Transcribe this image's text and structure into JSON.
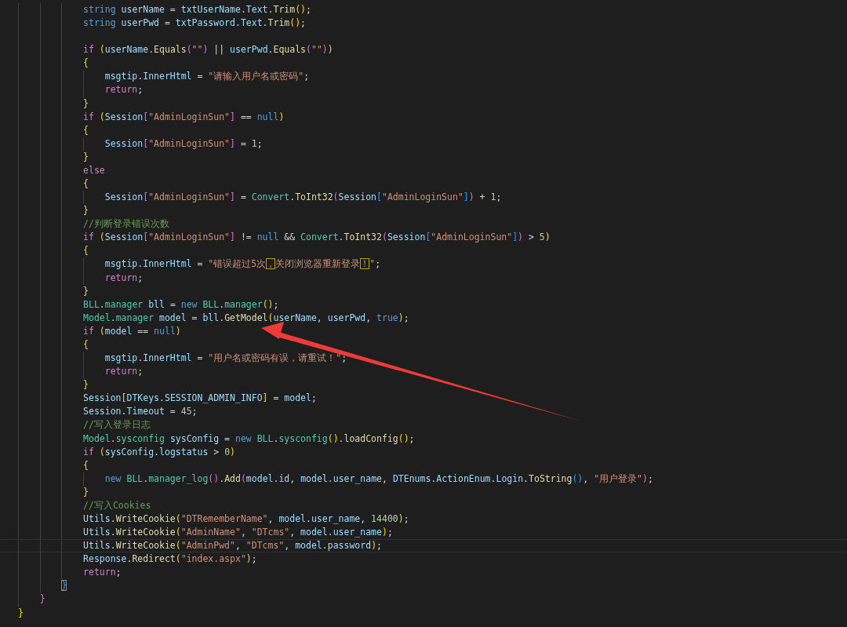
{
  "editor": {
    "lines": [
      {
        "kind": "code",
        "current": false,
        "tokens": [
          {
            "kind": "kw",
            "text": "            string "
          },
          {
            "kind": "var",
            "text": "userName"
          },
          {
            "kind": "plain",
            "text": " = "
          },
          {
            "kind": "var",
            "text": "txtUserName"
          },
          {
            "kind": "plain",
            "text": "."
          },
          {
            "kind": "var",
            "text": "Text"
          },
          {
            "kind": "plain",
            "text": "."
          },
          {
            "kind": "fn",
            "text": "Trim"
          },
          {
            "kind": "br1",
            "text": "()"
          },
          {
            "kind": "plain",
            "text": ";"
          }
        ]
      },
      {
        "kind": "code",
        "current": false,
        "tokens": [
          {
            "kind": "kw",
            "text": "            string "
          },
          {
            "kind": "var",
            "text": "userPwd"
          },
          {
            "kind": "plain",
            "text": " = "
          },
          {
            "kind": "var",
            "text": "txtPassword"
          },
          {
            "kind": "plain",
            "text": "."
          },
          {
            "kind": "var",
            "text": "Text"
          },
          {
            "kind": "plain",
            "text": "."
          },
          {
            "kind": "fn",
            "text": "Trim"
          },
          {
            "kind": "br1",
            "text": "()"
          },
          {
            "kind": "plain",
            "text": ";"
          }
        ]
      },
      {
        "kind": "blank",
        "current": false
      },
      {
        "kind": "code",
        "current": false,
        "tokens": [
          {
            "kind": "ctl",
            "text": "            if "
          },
          {
            "kind": "br1",
            "text": "("
          },
          {
            "kind": "var",
            "text": "userName"
          },
          {
            "kind": "plain",
            "text": "."
          },
          {
            "kind": "fn",
            "text": "Equals"
          },
          {
            "kind": "br2",
            "text": "("
          },
          {
            "kind": "str",
            "text": "\"\""
          },
          {
            "kind": "br2",
            "text": ")"
          },
          {
            "kind": "plain",
            "text": " || "
          },
          {
            "kind": "var",
            "text": "userPwd"
          },
          {
            "kind": "plain",
            "text": "."
          },
          {
            "kind": "fn",
            "text": "Equals"
          },
          {
            "kind": "br2",
            "text": "("
          },
          {
            "kind": "str",
            "text": "\"\""
          },
          {
            "kind": "br2",
            "text": ")"
          },
          {
            "kind": "br1",
            "text": ")"
          }
        ]
      },
      {
        "kind": "code",
        "current": false,
        "tokens": [
          {
            "kind": "br1",
            "text": "            {"
          }
        ]
      },
      {
        "kind": "code",
        "current": false,
        "tokens": [
          {
            "kind": "var",
            "text": "                msgtip"
          },
          {
            "kind": "plain",
            "text": "."
          },
          {
            "kind": "var",
            "text": "InnerHtml"
          },
          {
            "kind": "plain",
            "text": " = "
          },
          {
            "kind": "str",
            "text": "\"请输入用户名或密码\""
          },
          {
            "kind": "plain",
            "text": ";"
          }
        ]
      },
      {
        "kind": "code",
        "current": false,
        "tokens": [
          {
            "kind": "ctl",
            "text": "                return"
          },
          {
            "kind": "plain",
            "text": ";"
          }
        ]
      },
      {
        "kind": "code",
        "current": false,
        "tokens": [
          {
            "kind": "br1",
            "text": "            }"
          }
        ]
      },
      {
        "kind": "code",
        "current": false,
        "tokens": [
          {
            "kind": "ctl",
            "text": "            if "
          },
          {
            "kind": "br1",
            "text": "("
          },
          {
            "kind": "var",
            "text": "Session"
          },
          {
            "kind": "br2",
            "text": "["
          },
          {
            "kind": "str",
            "text": "\"AdminLoginSun\""
          },
          {
            "kind": "br2",
            "text": "]"
          },
          {
            "kind": "plain",
            "text": " == "
          },
          {
            "kind": "kw",
            "text": "null"
          },
          {
            "kind": "br1",
            "text": ")"
          }
        ]
      },
      {
        "kind": "code",
        "current": false,
        "tokens": [
          {
            "kind": "br1",
            "text": "            {"
          }
        ]
      },
      {
        "kind": "code",
        "current": false,
        "tokens": [
          {
            "kind": "var",
            "text": "                Session"
          },
          {
            "kind": "br2",
            "text": "["
          },
          {
            "kind": "str",
            "text": "\"AdminLoginSun\""
          },
          {
            "kind": "br2",
            "text": "]"
          },
          {
            "kind": "plain",
            "text": " = "
          },
          {
            "kind": "num",
            "text": "1"
          },
          {
            "kind": "plain",
            "text": ";"
          }
        ]
      },
      {
        "kind": "code",
        "current": false,
        "tokens": [
          {
            "kind": "br1",
            "text": "            }"
          }
        ]
      },
      {
        "kind": "code",
        "current": false,
        "tokens": [
          {
            "kind": "ctl",
            "text": "            else"
          }
        ]
      },
      {
        "kind": "code",
        "current": false,
        "tokens": [
          {
            "kind": "br1",
            "text": "            {"
          }
        ]
      },
      {
        "kind": "code",
        "current": false,
        "tokens": [
          {
            "kind": "var",
            "text": "                Session"
          },
          {
            "kind": "br2",
            "text": "["
          },
          {
            "kind": "str",
            "text": "\"AdminLoginSun\""
          },
          {
            "kind": "br2",
            "text": "]"
          },
          {
            "kind": "plain",
            "text": " = "
          },
          {
            "kind": "type",
            "text": "Convert"
          },
          {
            "kind": "plain",
            "text": "."
          },
          {
            "kind": "fn",
            "text": "ToInt32"
          },
          {
            "kind": "br2",
            "text": "("
          },
          {
            "kind": "var",
            "text": "Session"
          },
          {
            "kind": "br3",
            "text": "["
          },
          {
            "kind": "str",
            "text": "\"AdminLoginSun\""
          },
          {
            "kind": "br3",
            "text": "]"
          },
          {
            "kind": "br2",
            "text": ")"
          },
          {
            "kind": "plain",
            "text": " + "
          },
          {
            "kind": "num",
            "text": "1"
          },
          {
            "kind": "plain",
            "text": ";"
          }
        ]
      },
      {
        "kind": "code",
        "current": false,
        "tokens": [
          {
            "kind": "br1",
            "text": "            }"
          }
        ]
      },
      {
        "kind": "code",
        "current": false,
        "tokens": [
          {
            "kind": "com",
            "text": "            //判断登录错误次数"
          }
        ]
      },
      {
        "kind": "code",
        "current": false,
        "tokens": [
          {
            "kind": "ctl",
            "text": "            if "
          },
          {
            "kind": "br1",
            "text": "("
          },
          {
            "kind": "var",
            "text": "Session"
          },
          {
            "kind": "br2",
            "text": "["
          },
          {
            "kind": "str",
            "text": "\"AdminLoginSun\""
          },
          {
            "kind": "br2",
            "text": "]"
          },
          {
            "kind": "plain",
            "text": " != "
          },
          {
            "kind": "kw",
            "text": "null"
          },
          {
            "kind": "plain",
            "text": " && "
          },
          {
            "kind": "type",
            "text": "Convert"
          },
          {
            "kind": "plain",
            "text": "."
          },
          {
            "kind": "fn",
            "text": "ToInt32"
          },
          {
            "kind": "br2",
            "text": "("
          },
          {
            "kind": "var",
            "text": "Session"
          },
          {
            "kind": "br3",
            "text": "["
          },
          {
            "kind": "str",
            "text": "\"AdminLoginSun\""
          },
          {
            "kind": "br3",
            "text": "]"
          },
          {
            "kind": "br2",
            "text": ")"
          },
          {
            "kind": "plain",
            "text": " > "
          },
          {
            "kind": "num",
            "text": "5"
          },
          {
            "kind": "br1",
            "text": ")"
          }
        ]
      },
      {
        "kind": "code",
        "current": false,
        "tokens": [
          {
            "kind": "br1",
            "text": "            {"
          }
        ]
      },
      {
        "kind": "code",
        "current": false,
        "tokens": [
          {
            "kind": "var",
            "text": "                msgtip"
          },
          {
            "kind": "plain",
            "text": "."
          },
          {
            "kind": "var",
            "text": "InnerHtml"
          },
          {
            "kind": "plain",
            "text": " = "
          },
          {
            "kind": "str",
            "text": "\"错误超过5次"
          },
          {
            "kind": "flag",
            "text": "，"
          },
          {
            "kind": "str",
            "text": "关闭浏览器重新登录"
          },
          {
            "kind": "flag",
            "text": "！"
          },
          {
            "kind": "str",
            "text": "\""
          },
          {
            "kind": "plain",
            "text": ";"
          }
        ]
      },
      {
        "kind": "code",
        "current": false,
        "tokens": [
          {
            "kind": "ctl",
            "text": "                return"
          },
          {
            "kind": "plain",
            "text": ";"
          }
        ]
      },
      {
        "kind": "code",
        "current": false,
        "tokens": [
          {
            "kind": "br1",
            "text": "            }"
          }
        ]
      },
      {
        "kind": "code",
        "current": false,
        "tokens": [
          {
            "kind": "type",
            "text": "            BLL"
          },
          {
            "kind": "plain",
            "text": "."
          },
          {
            "kind": "type",
            "text": "manager "
          },
          {
            "kind": "var",
            "text": "bll"
          },
          {
            "kind": "plain",
            "text": " = "
          },
          {
            "kind": "kw",
            "text": "new "
          },
          {
            "kind": "type",
            "text": "BLL"
          },
          {
            "kind": "plain",
            "text": "."
          },
          {
            "kind": "type",
            "text": "manager"
          },
          {
            "kind": "br1",
            "text": "()"
          },
          {
            "kind": "plain",
            "text": ";"
          }
        ]
      },
      {
        "kind": "code",
        "current": false,
        "tokens": [
          {
            "kind": "type",
            "text": "            Model"
          },
          {
            "kind": "plain",
            "text": "."
          },
          {
            "kind": "type",
            "text": "manager "
          },
          {
            "kind": "var",
            "text": "model"
          },
          {
            "kind": "plain",
            "text": " = "
          },
          {
            "kind": "var",
            "text": "bll"
          },
          {
            "kind": "plain",
            "text": "."
          },
          {
            "kind": "fn",
            "text": "GetModel"
          },
          {
            "kind": "br1",
            "text": "("
          },
          {
            "kind": "var",
            "text": "userName"
          },
          {
            "kind": "plain",
            "text": ", "
          },
          {
            "kind": "var",
            "text": "userPwd"
          },
          {
            "kind": "plain",
            "text": ", "
          },
          {
            "kind": "kw",
            "text": "true"
          },
          {
            "kind": "br1",
            "text": ")"
          },
          {
            "kind": "plain",
            "text": ";"
          }
        ]
      },
      {
        "kind": "code",
        "current": false,
        "tokens": [
          {
            "kind": "ctl",
            "text": "            if "
          },
          {
            "kind": "br1",
            "text": "("
          },
          {
            "kind": "var",
            "text": "model"
          },
          {
            "kind": "plain",
            "text": " == "
          },
          {
            "kind": "kw",
            "text": "null"
          },
          {
            "kind": "br1",
            "text": ")"
          }
        ]
      },
      {
        "kind": "code",
        "current": false,
        "tokens": [
          {
            "kind": "br1",
            "text": "            {"
          }
        ]
      },
      {
        "kind": "code",
        "current": false,
        "tokens": [
          {
            "kind": "var",
            "text": "                msgtip"
          },
          {
            "kind": "plain",
            "text": "."
          },
          {
            "kind": "var",
            "text": "InnerHtml"
          },
          {
            "kind": "plain",
            "text": " = "
          },
          {
            "kind": "str",
            "text": "\"用户名或密码有误，请重试！\""
          },
          {
            "kind": "plain",
            "text": ";"
          }
        ]
      },
      {
        "kind": "code",
        "current": false,
        "tokens": [
          {
            "kind": "ctl",
            "text": "                return"
          },
          {
            "kind": "plain",
            "text": ";"
          }
        ]
      },
      {
        "kind": "code",
        "current": false,
        "tokens": [
          {
            "kind": "br1",
            "text": "            }"
          }
        ]
      },
      {
        "kind": "code",
        "current": false,
        "tokens": [
          {
            "kind": "var",
            "text": "            Session"
          },
          {
            "kind": "br1",
            "text": "["
          },
          {
            "kind": "var",
            "text": "DTKeys"
          },
          {
            "kind": "plain",
            "text": "."
          },
          {
            "kind": "var",
            "text": "SESSION_ADMIN_INFO"
          },
          {
            "kind": "br1",
            "text": "]"
          },
          {
            "kind": "plain",
            "text": " = "
          },
          {
            "kind": "var",
            "text": "model"
          },
          {
            "kind": "plain",
            "text": ";"
          }
        ]
      },
      {
        "kind": "code",
        "current": false,
        "tokens": [
          {
            "kind": "var",
            "text": "            Session"
          },
          {
            "kind": "plain",
            "text": "."
          },
          {
            "kind": "var",
            "text": "Timeout"
          },
          {
            "kind": "plain",
            "text": " = "
          },
          {
            "kind": "num",
            "text": "45"
          },
          {
            "kind": "plain",
            "text": ";"
          }
        ]
      },
      {
        "kind": "code",
        "current": false,
        "tokens": [
          {
            "kind": "com",
            "text": "            //写入登录日志"
          }
        ]
      },
      {
        "kind": "code",
        "current": false,
        "tokens": [
          {
            "kind": "type",
            "text": "            Model"
          },
          {
            "kind": "plain",
            "text": "."
          },
          {
            "kind": "type",
            "text": "sysconfig "
          },
          {
            "kind": "var",
            "text": "sysConfig"
          },
          {
            "kind": "plain",
            "text": " = "
          },
          {
            "kind": "kw",
            "text": "new "
          },
          {
            "kind": "type",
            "text": "BLL"
          },
          {
            "kind": "plain",
            "text": "."
          },
          {
            "kind": "type",
            "text": "sysconfig"
          },
          {
            "kind": "br1",
            "text": "()"
          },
          {
            "kind": "plain",
            "text": "."
          },
          {
            "kind": "fn",
            "text": "loadConfig"
          },
          {
            "kind": "br1",
            "text": "()"
          },
          {
            "kind": "plain",
            "text": ";"
          }
        ]
      },
      {
        "kind": "code",
        "current": false,
        "tokens": [
          {
            "kind": "ctl",
            "text": "            if "
          },
          {
            "kind": "br1",
            "text": "("
          },
          {
            "kind": "var",
            "text": "sysConfig"
          },
          {
            "kind": "plain",
            "text": "."
          },
          {
            "kind": "var",
            "text": "logstatus"
          },
          {
            "kind": "plain",
            "text": " > "
          },
          {
            "kind": "num",
            "text": "0"
          },
          {
            "kind": "br1",
            "text": ")"
          }
        ]
      },
      {
        "kind": "code",
        "current": false,
        "tokens": [
          {
            "kind": "br1",
            "text": "            {"
          }
        ]
      },
      {
        "kind": "code",
        "current": false,
        "tokens": [
          {
            "kind": "kw",
            "text": "                new "
          },
          {
            "kind": "type",
            "text": "BLL"
          },
          {
            "kind": "plain",
            "text": "."
          },
          {
            "kind": "type",
            "text": "manager_log"
          },
          {
            "kind": "br2",
            "text": "()"
          },
          {
            "kind": "plain",
            "text": "."
          },
          {
            "kind": "fn",
            "text": "Add"
          },
          {
            "kind": "br2",
            "text": "("
          },
          {
            "kind": "var",
            "text": "model"
          },
          {
            "kind": "plain",
            "text": "."
          },
          {
            "kind": "var",
            "text": "id"
          },
          {
            "kind": "plain",
            "text": ", "
          },
          {
            "kind": "var",
            "text": "model"
          },
          {
            "kind": "plain",
            "text": "."
          },
          {
            "kind": "var",
            "text": "user_name"
          },
          {
            "kind": "plain",
            "text": ", "
          },
          {
            "kind": "var",
            "text": "DTEnums"
          },
          {
            "kind": "plain",
            "text": "."
          },
          {
            "kind": "var",
            "text": "ActionEnum"
          },
          {
            "kind": "plain",
            "text": "."
          },
          {
            "kind": "var",
            "text": "Login"
          },
          {
            "kind": "plain",
            "text": "."
          },
          {
            "kind": "fn",
            "text": "ToString"
          },
          {
            "kind": "br3",
            "text": "()"
          },
          {
            "kind": "plain",
            "text": ", "
          },
          {
            "kind": "str",
            "text": "\"用户登录\""
          },
          {
            "kind": "br2",
            "text": ")"
          },
          {
            "kind": "plain",
            "text": ";"
          }
        ]
      },
      {
        "kind": "code",
        "current": false,
        "tokens": [
          {
            "kind": "br1",
            "text": "            }"
          }
        ]
      },
      {
        "kind": "code",
        "current": false,
        "tokens": [
          {
            "kind": "com",
            "text": "            //写入Cookies"
          }
        ]
      },
      {
        "kind": "code",
        "current": false,
        "tokens": [
          {
            "kind": "var",
            "text": "            Utils"
          },
          {
            "kind": "plain",
            "text": "."
          },
          {
            "kind": "fn",
            "text": "WriteCookie"
          },
          {
            "kind": "br1",
            "text": "("
          },
          {
            "kind": "str",
            "text": "\"DTRememberName\""
          },
          {
            "kind": "plain",
            "text": ", "
          },
          {
            "kind": "var",
            "text": "model"
          },
          {
            "kind": "plain",
            "text": "."
          },
          {
            "kind": "var",
            "text": "user_name"
          },
          {
            "kind": "plain",
            "text": ", "
          },
          {
            "kind": "num",
            "text": "14400"
          },
          {
            "kind": "br1",
            "text": ")"
          },
          {
            "kind": "plain",
            "text": ";"
          }
        ]
      },
      {
        "kind": "code",
        "current": false,
        "tokens": [
          {
            "kind": "var",
            "text": "            Utils"
          },
          {
            "kind": "plain",
            "text": "."
          },
          {
            "kind": "fn",
            "text": "WriteCookie"
          },
          {
            "kind": "br1",
            "text": "("
          },
          {
            "kind": "str",
            "text": "\"AdminName\""
          },
          {
            "kind": "plain",
            "text": ", "
          },
          {
            "kind": "str",
            "text": "\"DTcms\""
          },
          {
            "kind": "plain",
            "text": ", "
          },
          {
            "kind": "var",
            "text": "model"
          },
          {
            "kind": "plain",
            "text": "."
          },
          {
            "kind": "var",
            "text": "user_name"
          },
          {
            "kind": "br1",
            "text": ")"
          },
          {
            "kind": "plain",
            "text": ";"
          }
        ]
      },
      {
        "kind": "code",
        "current": true,
        "tokens": [
          {
            "kind": "var",
            "text": "            Utils"
          },
          {
            "kind": "plain",
            "text": "."
          },
          {
            "kind": "fn",
            "text": "WriteCookie"
          },
          {
            "kind": "br1",
            "text": "("
          },
          {
            "kind": "str",
            "text": "\"AdminPwd\""
          },
          {
            "kind": "plain",
            "text": ", "
          },
          {
            "kind": "str",
            "text": "\"DTcms\""
          },
          {
            "kind": "plain",
            "text": ", "
          },
          {
            "kind": "var",
            "text": "model"
          },
          {
            "kind": "plain",
            "text": "."
          },
          {
            "kind": "var",
            "text": "password"
          },
          {
            "kind": "br1",
            "text": ")"
          },
          {
            "kind": "plain",
            "text": ";"
          }
        ]
      },
      {
        "kind": "code",
        "current": false,
        "tokens": [
          {
            "kind": "var",
            "text": "            Response"
          },
          {
            "kind": "plain",
            "text": "."
          },
          {
            "kind": "fn",
            "text": "Redirect"
          },
          {
            "kind": "br1",
            "text": "("
          },
          {
            "kind": "str",
            "text": "\"index.aspx\""
          },
          {
            "kind": "br1",
            "text": ")"
          },
          {
            "kind": "plain",
            "text": ";"
          }
        ]
      },
      {
        "kind": "code",
        "current": false,
        "tokens": [
          {
            "kind": "ctl",
            "text": "            return"
          },
          {
            "kind": "plain",
            "text": ";"
          }
        ]
      },
      {
        "kind": "code",
        "current": false,
        "tokens": [
          {
            "kind": "match",
            "text": "        }"
          }
        ]
      },
      {
        "kind": "code",
        "current": false,
        "tokens": [
          {
            "kind": "br2",
            "text": "    }"
          }
        ]
      },
      {
        "kind": "code",
        "current": false,
        "tokens": [
          {
            "kind": "br1",
            "text": "}"
          }
        ]
      }
    ]
  }
}
